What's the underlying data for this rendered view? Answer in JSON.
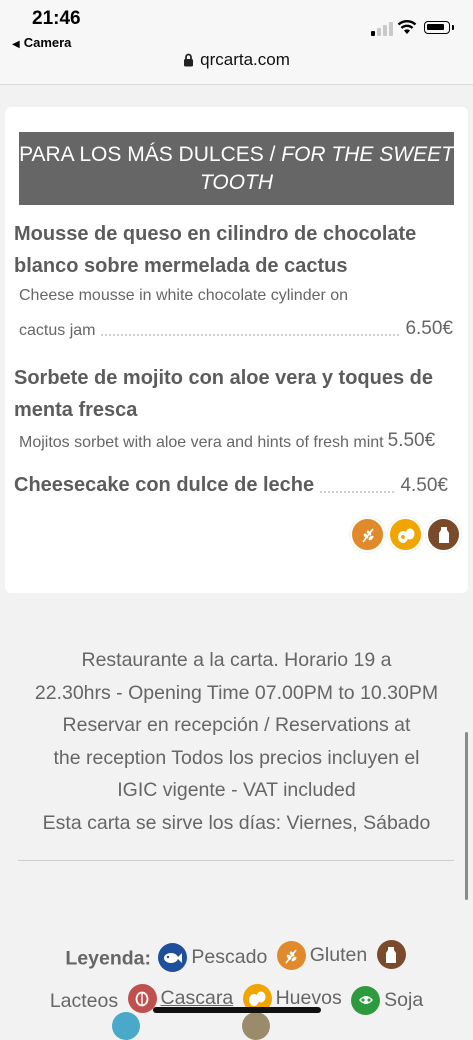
{
  "status": {
    "time": "21:46",
    "back_label": "Camera"
  },
  "browser": {
    "url": "qrcarta.com"
  },
  "section": {
    "title_es": "PARA LOS MÁS DULCES /",
    "title_en": "FOR THE SWEET TOOTH"
  },
  "items": [
    {
      "name": "Mousse de queso en cilindro de chocolate blanco sobre mermelada de cactus",
      "desc_line1": "Cheese mousse in white chocolate cylinder on",
      "desc_line2": "cactus jam",
      "price": "6.50€"
    },
    {
      "name": "Sorbete de mojito con aloe vera y toques de menta fresca",
      "desc": "Mojitos sorbet with aloe vera and hints of fresh mint",
      "price": "5.50€"
    },
    {
      "name": "Cheesecake con dulce de leche",
      "price": "4.50€"
    }
  ],
  "allergen_icons": [
    "gluten-icon",
    "eggs-icon",
    "dairy-icon"
  ],
  "footer": {
    "lines": [
      "Restaurante a la carta. Horario 19 a",
      "22.30hrs - Opening Time 07.00PM to 10.30PM",
      "Reservar en recepción / Reservations at",
      "the reception Todos los precios incluyen el",
      "IGIC vigente - VAT included",
      "Esta carta se sirve los días: Viernes, Sábado"
    ]
  },
  "legend": {
    "title": "Leyenda:",
    "items": [
      {
        "label": "Pescado",
        "icon": "fish-icon",
        "color": "#1f4e9a"
      },
      {
        "label": "Gluten",
        "icon": "gluten-icon",
        "color": "#e08a2c"
      },
      {
        "label": "Lacteos",
        "icon": "dairy-icon",
        "color": "#7a4b2a"
      },
      {
        "label": "Cascara",
        "icon": "nuts-icon",
        "color": "#c0504d"
      },
      {
        "label": "Huevos",
        "icon": "eggs-icon",
        "color": "#f0a500"
      },
      {
        "label": "Soja",
        "icon": "soy-icon",
        "color": "#2e9a3e"
      }
    ]
  },
  "colors": {
    "banner": "#666666",
    "gluten": "#e08a2c",
    "eggs": "#f0a500",
    "dairy": "#7a4b2a"
  }
}
